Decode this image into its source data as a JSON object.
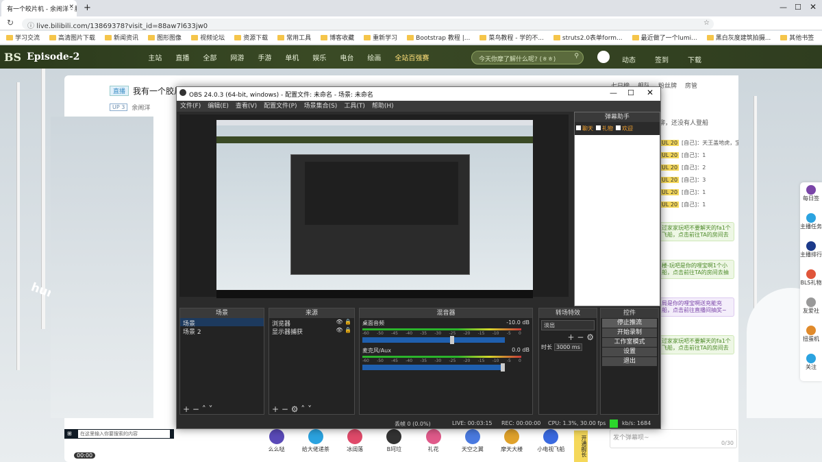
{
  "browser": {
    "tab_title": "有一个皎片机 - 余闹洋 - 脚哩...",
    "new_tab": "+",
    "url": "live.bilibili.com/13869378?visit_id=88aw7l633jw0",
    "bookmarks": [
      "学习交流",
      "高清图片下载",
      "新闻资讯",
      "图形图像",
      "视频论坛",
      "资源下载",
      "常用工具",
      "博客收藏",
      "重新学习",
      "Bootstrap 教程 |...",
      "菜鸟教程 - 学的不...",
      "struts2.0表单form...",
      "最近做了一个lumi...",
      "黑白灰度建筑拍摄...",
      "其他书签"
    ]
  },
  "bili": {
    "logo": "Episode-2",
    "nav": [
      "主站",
      "直播",
      "全部",
      "网游",
      "手游",
      "单机",
      "娱乐",
      "电台",
      "绘画",
      "全站百强赛"
    ],
    "search_placeholder": "今天你摩了解什么呢? (ㅎㅎ)",
    "right_nav": [
      "动态",
      "签到",
      "下载"
    ],
    "room_badge": "直播",
    "room_title": "我有一个胶片机",
    "up_badge": "UP 3",
    "up_name": "余闹洋",
    "gifts": [
      "么么哒",
      "给大佬递茶",
      "冰阔落",
      "B坷垃",
      "礼花",
      "天空之翼",
      "摩天大楼",
      "小电视飞船"
    ],
    "rank_label": "00:00",
    "send_btn": "开通舰长",
    "rtabs": [
      "七日榜",
      "舰队",
      "粉丝牌",
      "房管"
    ],
    "notice": "聊，还没有人登船",
    "chat": [
      "[自己]：天王盖地虎，宝",
      "[自己]：1",
      "[自己]：2",
      "[自己]：3",
      "[自己]：1",
      "[自己]：1"
    ],
    "chat_tags": [
      "UL 20",
      "UL 20",
      "UL 20",
      "UL 20",
      "UL 20",
      "UL 20"
    ],
    "notes": [
      {
        "text": "过家家玩吧不要解天的fa1个飞船，点击前往TA的房间去",
        "kind": "g"
      },
      {
        "text": "楼-玩吧是你的哩宝啊1个小船，点击前往TA的房间去抽",
        "kind": "g"
      },
      {
        "text": "局是你的哩宝啊送充能充船，点击前往直播间抽奖~",
        "kind": "p"
      },
      {
        "text": "过家家玩吧不要解天的fa1个飞船，点击前往TA的房间去",
        "kind": "g"
      }
    ],
    "danmaku_placeholder": "发个弹幕呗~",
    "danmaku_count": "0/30",
    "sidebar": [
      "每日签",
      "主播任务",
      "主播排行",
      "BLS礼物",
      "友爱社",
      "扭蛋机",
      "关注"
    ]
  },
  "obs": {
    "title": "OBS 24.0.3 (64-bit, windows) - 配置文件: 未命名 - 场景: 未命名",
    "menu": [
      "文件(F)",
      "编辑(E)",
      "查看(V)",
      "配置文件(P)",
      "场景集合(S)",
      "工具(T)",
      "帮助(H)"
    ],
    "danmu_title": "弹幕助手",
    "danmu_checks": [
      "聊天",
      "礼物",
      "欢迎"
    ],
    "docks": {
      "scenes": {
        "title": "场景",
        "items": [
          "场景",
          "场景 2"
        ]
      },
      "sources": {
        "title": "来源",
        "items": [
          "浏览器",
          "显示器捕获"
        ]
      },
      "mixer": {
        "title": "混音器",
        "ch1": "桌面音频",
        "ch1_db": "-10.0 dB",
        "ch2": "麦克风/Aux",
        "ch2_db": "0.0 dB",
        "ticks": [
          "-60",
          "-50",
          "-45",
          "-40",
          "-35",
          "-30",
          "-25",
          "-20",
          "-15",
          "-10",
          "-5",
          "0"
        ]
      },
      "transitions": {
        "title": "转场特效",
        "type": "淡出",
        "duration_label": "时长",
        "duration": "3000 ms"
      },
      "controls": {
        "title": "控件",
        "buttons": [
          "停止推流",
          "开始录制",
          "工作室模式",
          "设置",
          "退出"
        ]
      }
    },
    "status": {
      "dropped": "丢帧 0 (0.0%)",
      "live": "LIVE: 00:03:15",
      "rec": "REC: 00:00:00",
      "cpu": "CPU: 1.3%, 30.00 fps",
      "kbps": "kb/s: 1684"
    }
  },
  "taskbar": {
    "search": "在这里输入你要搜索的内容"
  },
  "colors": {
    "bili_nav": "#2b3a1c",
    "obs_bg": "#2b2b2b",
    "accent_green": "#4e8b2a",
    "stream_indicator": "#2bd62b"
  }
}
